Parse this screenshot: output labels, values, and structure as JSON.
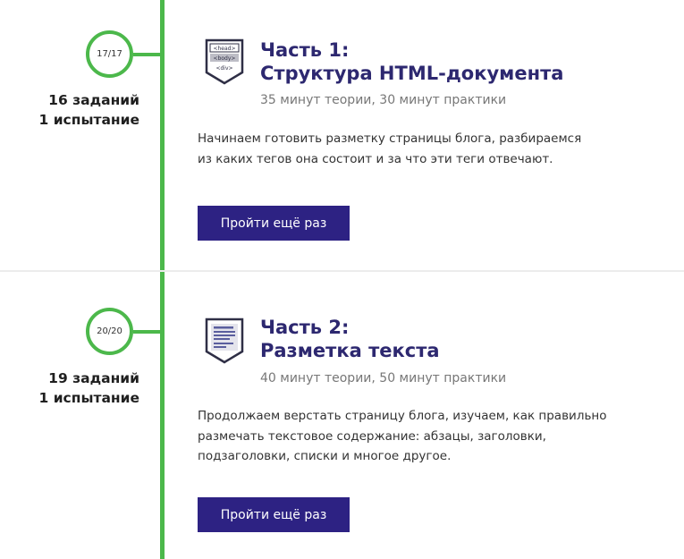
{
  "sections": [
    {
      "progress": "17/17",
      "tasks": "16 заданий",
      "trials": "1 испытание",
      "icon": "html-tags-icon",
      "icon_labels": [
        "<head>",
        "<body>",
        "<div>"
      ],
      "title_line1": "Часть 1:",
      "title_line2": "Структура HTML-документа",
      "duration": "35 минут теории, 30 минут практики",
      "desc_line1": "Начинаем готовить разметку страницы блога, разбираемся",
      "desc_line2": "из каких тегов она состоит и за что эти теги отвечают.",
      "button": "Пройти ещё раз"
    },
    {
      "progress": "20/20",
      "tasks": "19 заданий",
      "trials": "1 испытание",
      "icon": "text-document-icon",
      "title_line1": "Часть 2:",
      "title_line2": "Разметка текста",
      "duration": "40 минут теории, 50 минут практики",
      "desc_line1": "Продолжаем верстать страницу блога, изучаем, как правильно",
      "desc_line2": "размечать текстовое содержание: абзацы, заголовки,",
      "desc_line3": "подзаголовки, списки и многое другое.",
      "button": "Пройти ещё раз"
    }
  ],
  "colors": {
    "timeline": "#4cb84b",
    "title": "#2d2870",
    "button": "#2d2283"
  }
}
